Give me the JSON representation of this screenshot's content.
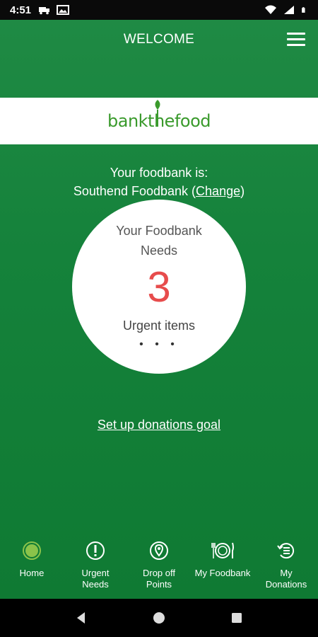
{
  "status_bar": {
    "time": "4:51",
    "left_icons": [
      "truck-icon",
      "image-icon"
    ],
    "right_icons": [
      "wifi-icon",
      "signal-icon",
      "battery-icon"
    ]
  },
  "header": {
    "title": "WELCOME",
    "menu_icon": "hamburger-menu-icon"
  },
  "logo": {
    "text": "bankthefood",
    "color": "#3a9a2c"
  },
  "foodbank": {
    "label": "Your foodbank is:",
    "name": "Southend Foodbank",
    "change_label": "Change"
  },
  "needs_card": {
    "title_line1": "Your Foodbank",
    "title_line2": "Needs",
    "count": "3",
    "subtitle": "Urgent items",
    "dots": "• • •",
    "count_color": "#e74c4c"
  },
  "goal_link": "Set up donations goal",
  "bottom_nav": {
    "items": [
      {
        "label_line1": "Home",
        "label_line2": "",
        "icon": "home-circle-icon",
        "active": true
      },
      {
        "label_line1": "Urgent",
        "label_line2": "Needs",
        "icon": "alert-icon",
        "active": false
      },
      {
        "label_line1": "Drop off",
        "label_line2": "Points",
        "icon": "location-pin-icon",
        "active": false
      },
      {
        "label_line1": "My Foodbank",
        "label_line2": "",
        "icon": "plate-cutlery-icon",
        "active": false
      },
      {
        "label_line1": "My",
        "label_line2": "Donations",
        "icon": "history-list-icon",
        "active": false
      }
    ]
  },
  "colors": {
    "brand_green": "#178a3c",
    "accent_light_green": "#8bc34a",
    "urgent_red": "#e74c4c"
  }
}
